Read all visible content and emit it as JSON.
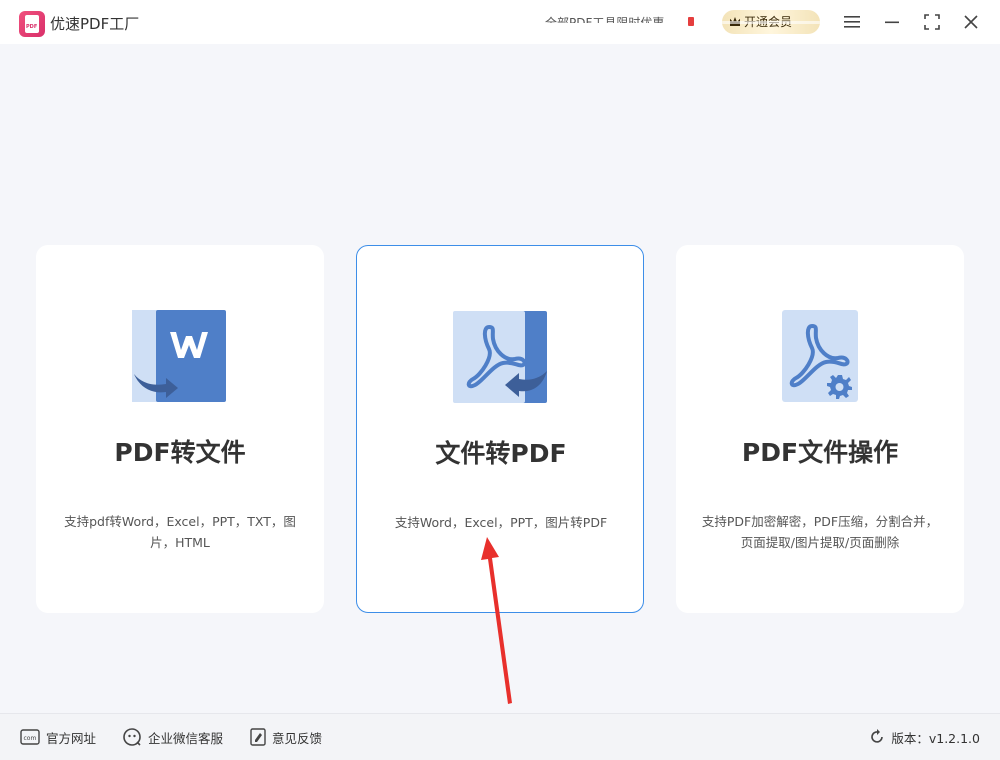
{
  "titlebar": {
    "app_title": "优速PDF工厂",
    "promo_text": "全部PDF工具限时优惠",
    "vip_label": "开通会员",
    "logo_text": "PDF"
  },
  "cards": [
    {
      "title": "PDF转文件",
      "description": "支持pdf转Word，Excel，PPT，TXT，图片，HTML",
      "icon": "pdf-to-word-icon",
      "selected": false
    },
    {
      "title": "文件转PDF",
      "description": "支持Word，Excel，PPT，图片转PDF",
      "icon": "file-to-pdf-icon",
      "selected": true
    },
    {
      "title": "PDF文件操作",
      "description": "支持PDF加密解密，PDF压缩，分割合并，页面提取/图片提取/页面删除",
      "icon": "pdf-operation-icon",
      "selected": false
    }
  ],
  "footer": {
    "website_label": "官方网址",
    "wechat_label": "企业微信客服",
    "feedback_label": "意见反馈",
    "version_label": "版本：v1.2.1.0",
    "website_icon_text": "com"
  },
  "colors": {
    "accent": "#3d8ee8",
    "icon_dark": "#4f7fc8",
    "icon_light": "#cfdff5",
    "annotation_arrow": "#e8302c"
  }
}
